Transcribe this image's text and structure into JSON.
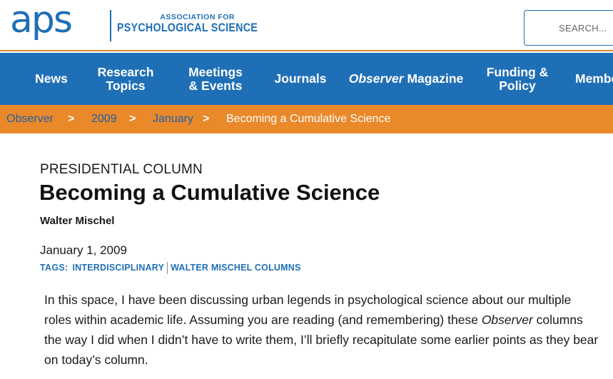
{
  "colors": {
    "brand_blue": "#1f6fb6",
    "brand_orange": "#e9892a",
    "crumb_link": "#1f5fa8"
  },
  "logo": {
    "mark": "aps",
    "line1": "ASSOCIATION FOR",
    "line2": "PSYCHOLOGICAL SCIENCE"
  },
  "search": {
    "placeholder": "SEARCH..."
  },
  "nav": {
    "news": "News",
    "research_line1": "Research",
    "research_line2": "Topics",
    "meetings_line1": "Meetings",
    "meetings_line2": "& Events",
    "journals": "Journals",
    "observer_italic": "Observer",
    "observer_rest": " Magazine",
    "funding_line1": "Funding &",
    "funding_line2": "Policy",
    "membership": "Membe"
  },
  "breadcrumb": {
    "items": [
      "Observer",
      "2009",
      "January"
    ],
    "separator": ">",
    "current": "Becoming a Cumulative Science"
  },
  "article": {
    "kicker": "PRESIDENTIAL COLUMN",
    "title": "Becoming a Cumulative Science",
    "author": "Walter Mischel",
    "date": "January 1, 2009",
    "tags_label": "TAGS:",
    "tags": [
      "INTERDISCIPLINARY",
      "WALTER MISCHEL COLUMNS"
    ],
    "body_part1": "In this space, I have been discussing urban legends in psychological science about our multiple roles within academic life. Assuming you are reading (and remembering) these ",
    "body_italic": "Observer",
    "body_part2": " columns the way I did when I didn’t have to write them, I’ll briefly recapitulate some earlier points as they bear on today’s column."
  }
}
